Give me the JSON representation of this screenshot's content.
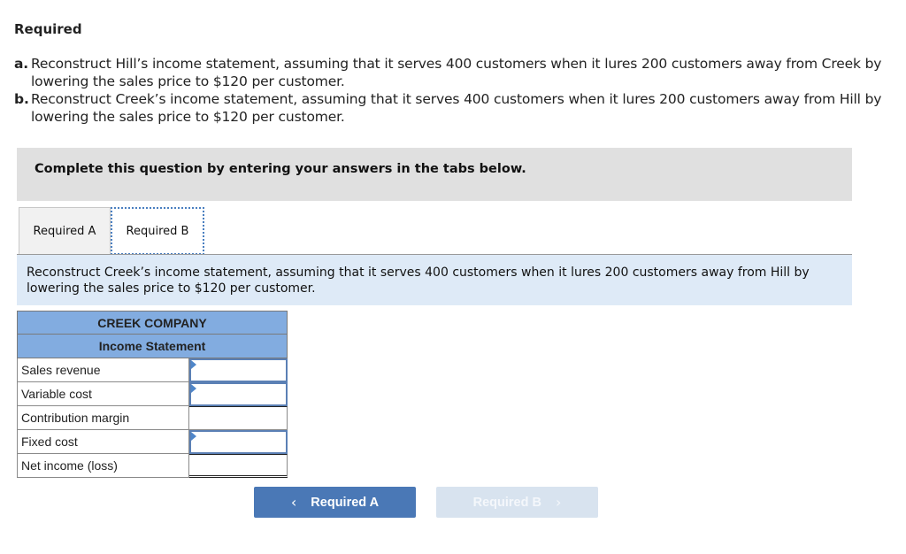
{
  "requirements": {
    "heading": "Required",
    "items": [
      {
        "letter": "a.",
        "text": "Reconstruct Hill’s income statement, assuming that it serves 400 customers when it lures 200 customers away from Creek by lowering the sales price to $120 per customer."
      },
      {
        "letter": "b.",
        "text": "Reconstruct Creek’s income statement, assuming that it serves 400 customers when it lures 200 customers away from Hill by lowering the sales price to $120 per customer."
      }
    ]
  },
  "instruction": "Complete this question by entering your answers in the tabs below.",
  "tabs": [
    {
      "label": "Required A",
      "active": false
    },
    {
      "label": "Required B",
      "active": true
    }
  ],
  "prompt": "Reconstruct Creek’s income statement, assuming that it serves 400 customers when it lures 200 customers away from Hill by lowering the sales price to $120 per customer.",
  "statement": {
    "company": "CREEK COMPANY",
    "title": "Income Statement",
    "rows": [
      {
        "label": "Sales revenue",
        "value": "",
        "editable": true
      },
      {
        "label": "Variable cost",
        "value": "",
        "editable": true
      },
      {
        "label": "Contribution margin",
        "value": "",
        "editable": false
      },
      {
        "label": "Fixed cost",
        "value": "",
        "editable": true
      },
      {
        "label": "Net income (loss)",
        "value": "",
        "editable": false
      }
    ]
  },
  "navigation": {
    "prev_label": "Required A",
    "next_label": "Required B",
    "prev_icon": "chevron-left-icon",
    "next_icon": "chevron-right-icon",
    "next_enabled": false
  },
  "colors": {
    "header_blue": "#82ace0",
    "prompt_bg": "#deeaf7",
    "button_blue": "#4a78b6",
    "button_disabled": "#d8e3ef",
    "instruction_bg": "#e0e0e0"
  }
}
